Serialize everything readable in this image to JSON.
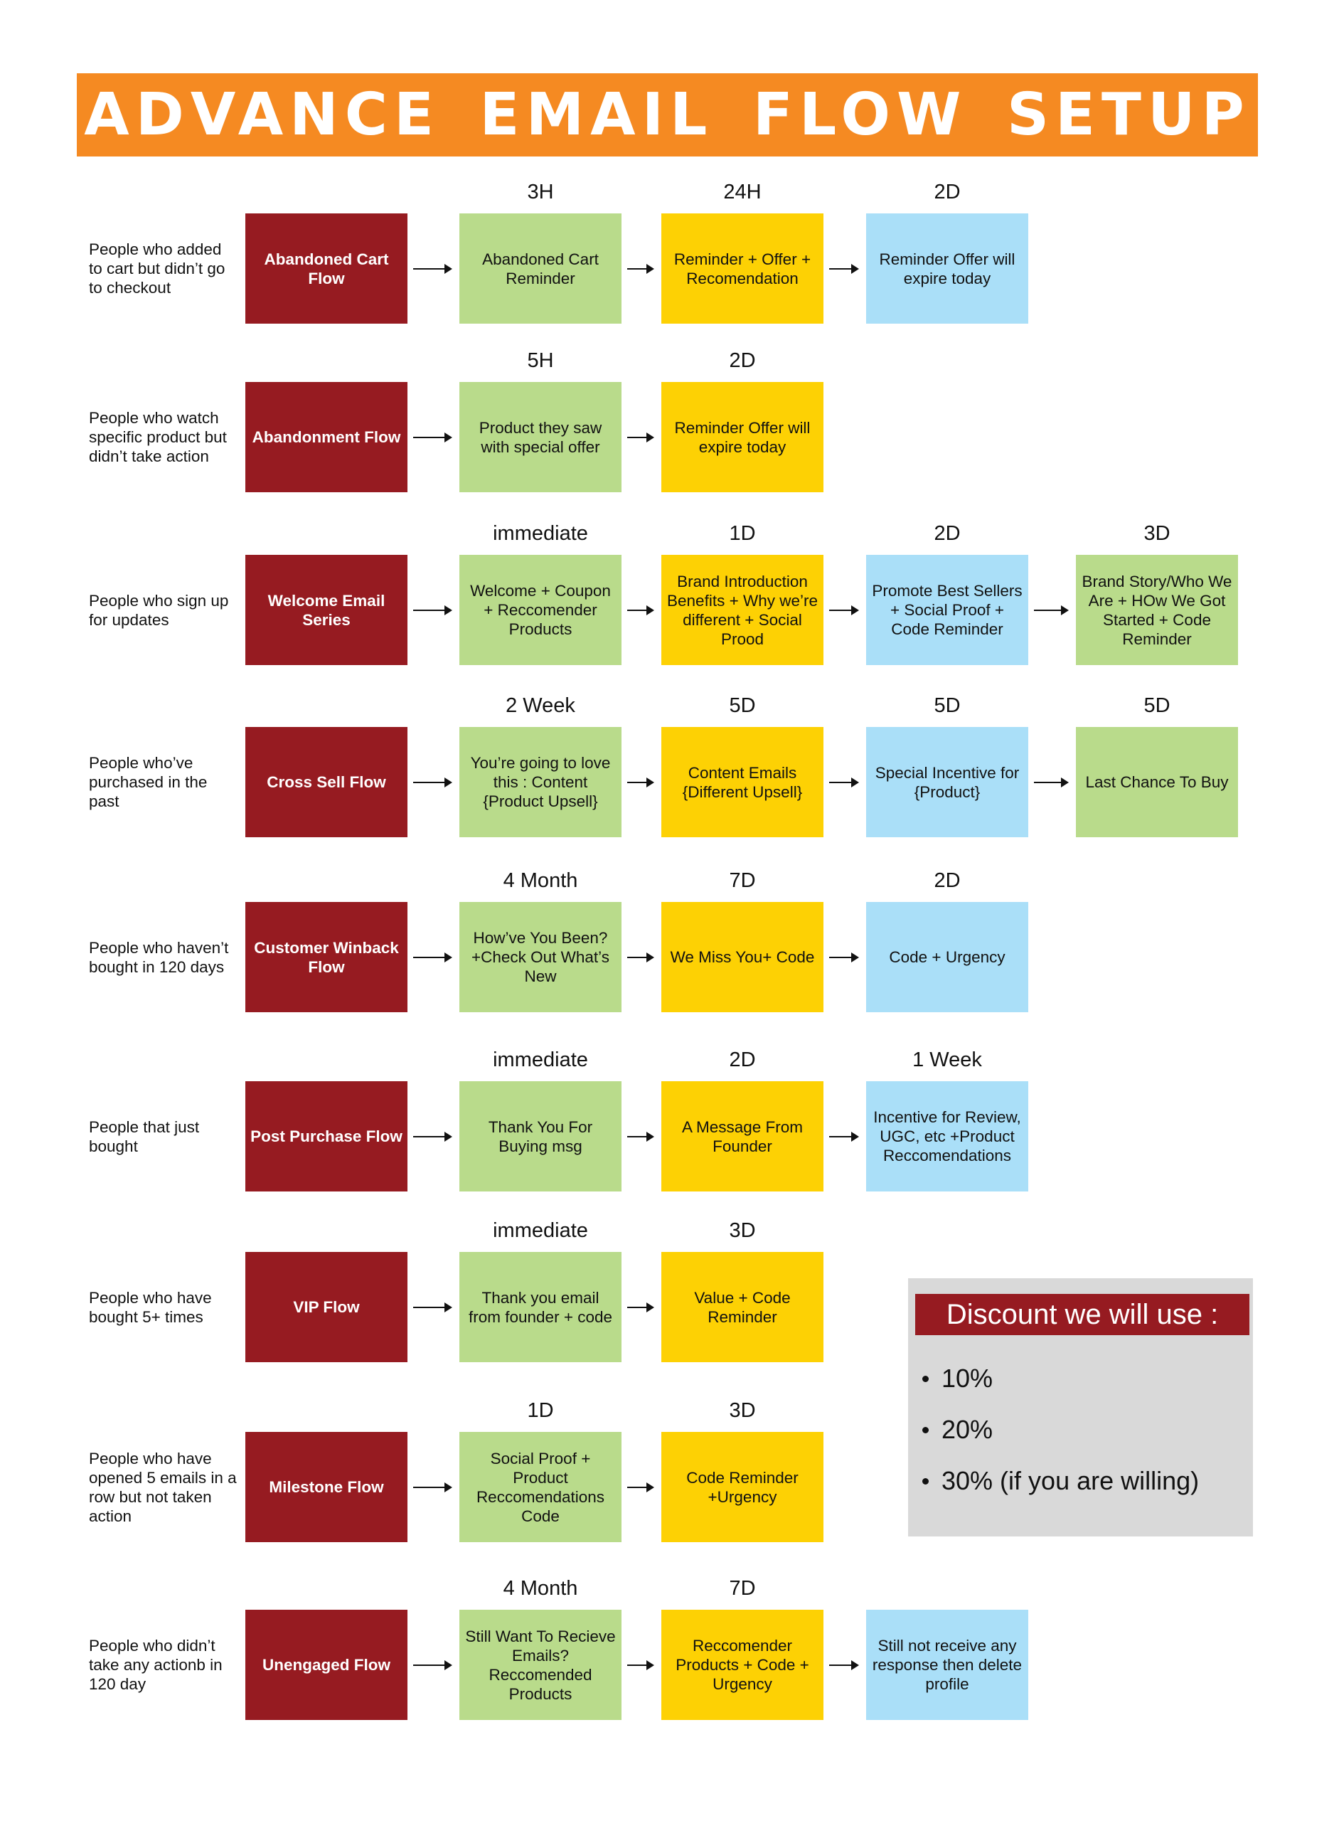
{
  "title": "ADVANCE EMAIL FLOW SETUP",
  "colors": {
    "banner": "#f58a22",
    "flow_box": "#961b21",
    "green": "#b9db8b",
    "yellow": "#fdd104",
    "blue": "#aadff8",
    "discount_panel": "#d9d9d9"
  },
  "flows": [
    {
      "audience": "People who added to cart but didn’t go to checkout",
      "name": "Abandoned Cart Flow",
      "steps": [
        {
          "timing": "3H",
          "text": "Abandoned Cart Reminder",
          "color": "green"
        },
        {
          "timing": "24H",
          "text": "Reminder + Offer + Recomendation",
          "color": "yellow"
        },
        {
          "timing": "2D",
          "text": "Reminder Offer will expire today",
          "color": "blue"
        }
      ]
    },
    {
      "audience": "People who watch specific product but didn’t take action",
      "name": "Abandonment Flow",
      "steps": [
        {
          "timing": "5H",
          "text": "Product they saw with special offer",
          "color": "green"
        },
        {
          "timing": "2D",
          "text": "Reminder Offer will expire today",
          "color": "yellow"
        }
      ]
    },
    {
      "audience": "People who sign up for updates",
      "name": "Welcome Email Series",
      "steps": [
        {
          "timing": "immediate",
          "text": "Welcome + Coupon + Reccomender Products",
          "color": "green"
        },
        {
          "timing": "1D",
          "text": "Brand Introduction Benefits + Why we’re different + Social Prood",
          "color": "yellow"
        },
        {
          "timing": "2D",
          "text": "Promote Best Sellers + Social Proof + Code Reminder",
          "color": "blue"
        },
        {
          "timing": "3D",
          "text": "Brand Story/Who We Are + HOw We Got Started + Code Reminder",
          "color": "green"
        }
      ]
    },
    {
      "audience": "People who’ve purchased in the past",
      "name": "Cross Sell Flow",
      "steps": [
        {
          "timing": "2 Week",
          "text": "You’re going to love this : Content {Product Upsell}",
          "color": "green"
        },
        {
          "timing": "5D",
          "text": "Content Emails {Different Upsell}",
          "color": "yellow"
        },
        {
          "timing": "5D",
          "text": "Special Incentive for {Product}",
          "color": "blue"
        },
        {
          "timing": "5D",
          "text": "Last Chance To Buy",
          "color": "green"
        }
      ]
    },
    {
      "audience": "People who haven’t bought in 120 days",
      "name": "Customer Winback Flow",
      "steps": [
        {
          "timing": "4 Month",
          "text": "How’ve You Been? +Check Out What’s New",
          "color": "green"
        },
        {
          "timing": "7D",
          "text": "We Miss You+ Code",
          "color": "yellow"
        },
        {
          "timing": "2D",
          "text": "Code + Urgency",
          "color": "blue"
        }
      ]
    },
    {
      "audience": "People that just bought",
      "name": "Post Purchase Flow",
      "steps": [
        {
          "timing": "immediate",
          "text": "Thank You For Buying msg",
          "color": "green"
        },
        {
          "timing": "2D",
          "text": "A Message From Founder",
          "color": "yellow"
        },
        {
          "timing": "1 Week",
          "text": "Incentive for Review, UGC, etc +Product Reccomendations",
          "color": "blue"
        }
      ]
    },
    {
      "audience": "People who have bought 5+ times",
      "name": "VIP Flow",
      "steps": [
        {
          "timing": "immediate",
          "text": "Thank you email from founder + code",
          "color": "green"
        },
        {
          "timing": "3D",
          "text": "Value + Code Reminder",
          "color": "yellow"
        }
      ]
    },
    {
      "audience": "People who have opened 5 emails in a row but not taken action",
      "name": "Milestone Flow",
      "steps": [
        {
          "timing": "1D",
          "text": "Social Proof + Product Reccomendations Code",
          "color": "green"
        },
        {
          "timing": "3D",
          "text": "Code Reminder +Urgency",
          "color": "yellow"
        }
      ]
    },
    {
      "audience": "People who didn’t take any actionb in 120 day",
      "name": "Unengaged Flow",
      "steps": [
        {
          "timing": "4 Month",
          "text": "Still Want To Recieve Emails? Reccomended Products",
          "color": "green"
        },
        {
          "timing": "7D",
          "text": "Reccomender Products + Code + Urgency",
          "color": "yellow"
        },
        {
          "timing": "",
          "text": "Still not receive any response then delete profile",
          "color": "blue"
        }
      ]
    }
  ],
  "discount": {
    "title": "Discount we will use :",
    "items": [
      "10%",
      "20%",
      "30% (if you are willing)"
    ]
  }
}
